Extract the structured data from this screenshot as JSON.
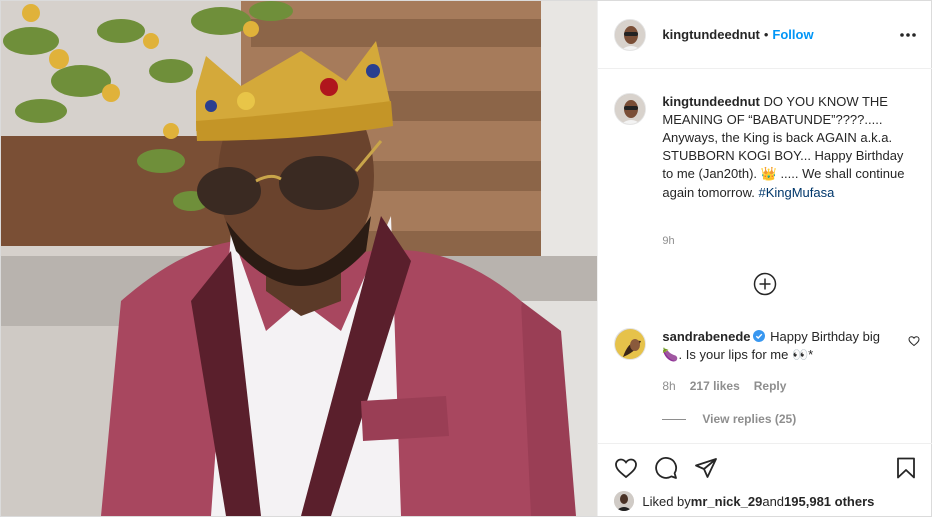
{
  "post": {
    "author": "kingtundeednut",
    "follow_label": "Follow",
    "separator": "•",
    "caption": {
      "username": "kingtundeednut",
      "text_before_emoji": "DO YOU KNOW THE MEANING OF “BABATUNDE”????..... Anyways, the King is back AGAIN a.k.a. STUBBORN KOGI BOY... Happy Birthday to me (Jan20th). ",
      "emoji": "👑",
      "text_after_emoji": " ..... We shall continue again tomorrow. ",
      "hashtag": "#KingMufasa",
      "time": "9h"
    },
    "comment": {
      "username": "sandrabenede",
      "verified": true,
      "text_part1": "Happy Birthday big ",
      "emoji1": "🍆",
      "text_part2": ". Is your lips for me ",
      "emoji2": "👀",
      "text_part3": "*",
      "time": "8h",
      "likes": "217 likes",
      "reply_label": "Reply",
      "view_replies": "View replies (25)"
    },
    "liked_by": {
      "prefix": "Liked by ",
      "user": "mr_nick_29",
      "middle": " and ",
      "others": "195,981 others"
    }
  },
  "colors": {
    "link_blue": "#0095f6",
    "hashtag": "#00376b",
    "muted": "#8e8e8e",
    "text": "#262626",
    "jacket": "#a8475f"
  },
  "icons": [
    "more-options-icon",
    "load-more-comments-icon",
    "verified-badge-icon",
    "comment-heart-icon",
    "like-heart-icon",
    "comment-bubble-icon",
    "share-direct-icon",
    "save-bookmark-icon"
  ]
}
